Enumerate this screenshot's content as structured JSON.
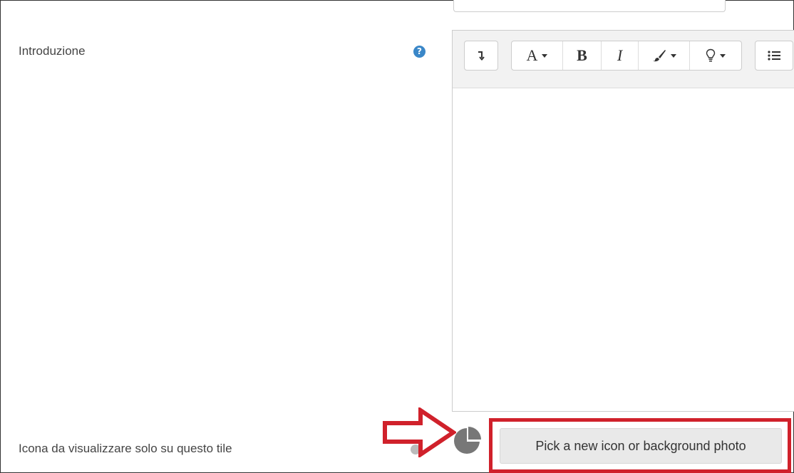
{
  "fields": {
    "intro_label": "Introduzione",
    "icon_label": "Icona da visualizzare solo su questo tile"
  },
  "help": {
    "icon": "question-circle-icon",
    "glyph": "?"
  },
  "editor": {
    "toolbar": {
      "expand_icon": "expand-toolbar-icon",
      "font_glyph": "A",
      "bold_glyph": "B",
      "italic_glyph": "I",
      "brush_icon": "paintbrush-icon",
      "lightbulb_icon": "lightbulb-icon",
      "list_icon": "unordered-list-icon"
    },
    "content": ""
  },
  "icon_picker": {
    "current_icon": "pie-chart-icon",
    "button_label": "Pick a new icon or background photo"
  },
  "colors": {
    "highlight": "#d0212b",
    "help": "#3a87c8",
    "icon": "#777777"
  }
}
